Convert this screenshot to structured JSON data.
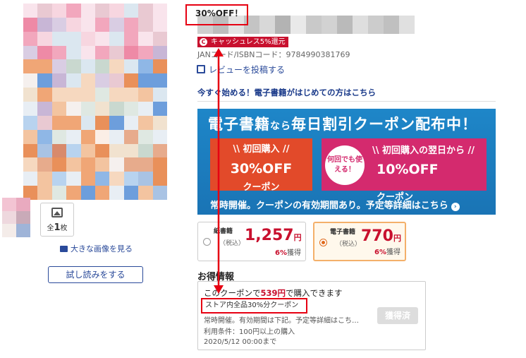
{
  "product": {
    "discount_badge": "30%OFF！",
    "cashless_badge": "キャッシュレス5%還元",
    "cashless_icon": "C",
    "jan_code": "JANコード/ISBNコード：9784990381769",
    "review_link": "レビューを投稿する",
    "ebook_promo_link": "今すぐ始める！電子書籍がはじめての方はこちら"
  },
  "gallery": {
    "image_count_prefix": "全",
    "image_count": "1",
    "image_count_suffix": "枚",
    "view_large_link": "大きな画像を見る",
    "trial_read_button": "試し読みをする"
  },
  "banner": {
    "headline_a": "電子書籍",
    "headline_b": "なら",
    "headline_c": "毎日割引クーポン配布中！",
    "card1_caption": "\\\\ 初回購入 //",
    "card1_value": "30",
    "card1_unit": "%OFF",
    "card1_sub": "クーポン",
    "card2_pill": "何回でも使える！",
    "card2_caption": "\\\\ 初回購入の翌日から //",
    "card2_value": "10",
    "card2_unit": "%OFF",
    "card2_sub": "クーポン",
    "footer": "常時開催。クーポンの有効期間あり。予定等詳細はこちら",
    "footer_arrow": "›"
  },
  "prices": {
    "paper": {
      "kind": "紙書籍",
      "tax": "（税込）",
      "price": "1,257",
      "yen": "円",
      "points": "6%",
      "points_label": "獲得"
    },
    "ebook": {
      "kind": "電子書籍",
      "tax": "（税込）",
      "price": "770",
      "yen": "円",
      "points": "6%",
      "points_label": "獲得"
    }
  },
  "deals": {
    "heading": "お得情報",
    "line1_a": "このクーポンで",
    "line1_price": "539円",
    "line1_b": "で購入できます",
    "coupon_name": "ストア内全品30%分クーポン",
    "coupon_desc": "常時開催。有効期間は下記。予定等詳細はこち…",
    "condition": "利用条件：100円以上の購入",
    "expiry": "2020/5/12 00:00まで",
    "acquired_button": "獲得済"
  },
  "colors": {
    "annotation_red": "#e60012",
    "link_blue": "#2a4a9a",
    "price_red": "#c8102e",
    "banner_blue": "#1a74b5"
  }
}
